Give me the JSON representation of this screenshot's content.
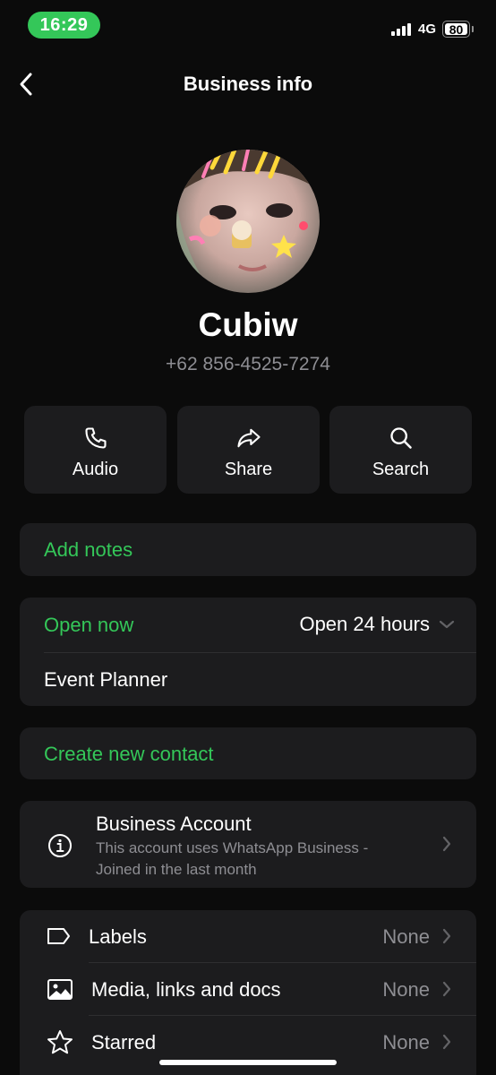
{
  "status_bar": {
    "time": "16:29",
    "network": "4G",
    "battery": "80"
  },
  "header": {
    "title": "Business info"
  },
  "profile": {
    "name": "Cubiw",
    "phone": "+62 856-4525-7274"
  },
  "actions": [
    {
      "label": "Audio",
      "icon": "phone-icon"
    },
    {
      "label": "Share",
      "icon": "share-icon"
    },
    {
      "label": "Search",
      "icon": "search-icon"
    }
  ],
  "notes": {
    "label": "Add notes"
  },
  "hours": {
    "status": "Open now",
    "value": "Open 24 hours",
    "category": "Event Planner"
  },
  "contact": {
    "label": "Create new contact"
  },
  "business_account": {
    "title": "Business Account",
    "description_line1": "This account uses WhatsApp Business -",
    "description_line2": "Joined in the last month"
  },
  "list": [
    {
      "label": "Labels",
      "value": "None",
      "icon": "label-icon"
    },
    {
      "label": "Media, links and docs",
      "value": "None",
      "icon": "image-icon"
    },
    {
      "label": "Starred",
      "value": "None",
      "icon": "star-icon"
    }
  ],
  "colors": {
    "accent": "#34c759",
    "card": "#1c1c1e",
    "background": "#0b0b0b",
    "secondary_text": "#8e8e93"
  }
}
